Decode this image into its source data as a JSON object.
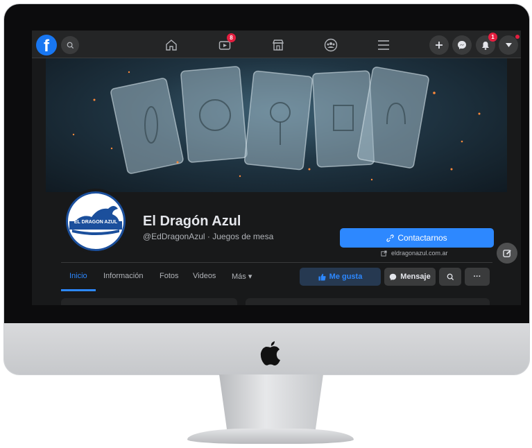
{
  "topbar": {
    "logo_letter": "f",
    "icons": [
      "search-icon",
      "home-icon",
      "watch-icon",
      "marketplace-icon",
      "groups-icon",
      "menu-icon",
      "create-plus-icon",
      "messenger-icon",
      "notifications-icon",
      "account-caret-icon"
    ],
    "watch_badge": "8",
    "notifications_badge": "1"
  },
  "page": {
    "name": "El Dragón Azul",
    "handle": "@EdDragonAzul · Juegos de mesa",
    "logo_text": "EL DRAGON AZUL",
    "contact_label": "Contactarnos",
    "website": "eldragonazul.com.ar"
  },
  "tabs": [
    {
      "label": "Inicio",
      "active": true
    },
    {
      "label": "Información",
      "active": false
    },
    {
      "label": "Fotos",
      "active": false
    },
    {
      "label": "Videos",
      "active": false
    },
    {
      "label": "Más ▾",
      "active": false
    }
  ],
  "actions": {
    "like_label": "Me gusta",
    "message_label": "Mensaje",
    "more_label": "···"
  },
  "colors": {
    "accent": "#2d88ff",
    "badge": "#e41e3f",
    "background": "#18191a",
    "surface": "#242526"
  }
}
